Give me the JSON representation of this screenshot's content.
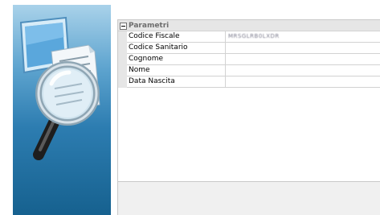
{
  "property_grid": {
    "category": "Parametri",
    "rows": [
      {
        "name": "Codice Fiscale",
        "value": "MRSGLRB0LXDR"
      },
      {
        "name": "Codice Sanitario",
        "value": ""
      },
      {
        "name": "Cognome",
        "value": ""
      },
      {
        "name": "Nome",
        "value": ""
      },
      {
        "name": "Data Nascita",
        "value": ""
      }
    ]
  },
  "banner": {
    "icon": "magnifying-glass-over-document-and-monitor",
    "colors": {
      "top": "#a9d2ea",
      "bottom": "#16618f"
    }
  }
}
